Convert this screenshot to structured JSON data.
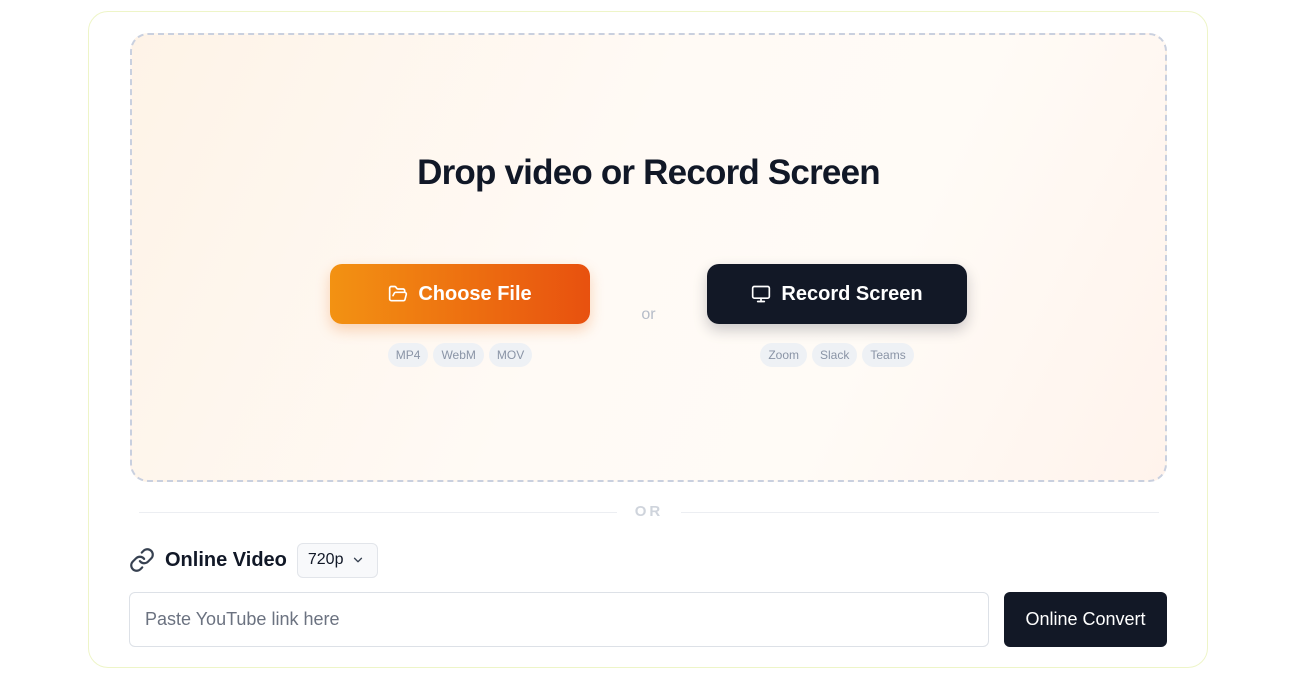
{
  "upload": {
    "title": "Drop video or Record Screen",
    "choose_file_label": "Choose File",
    "file_formats": [
      "MP4",
      "WebM",
      "MOV"
    ],
    "or_text": "or",
    "record_screen_label": "Record Screen",
    "record_sources": [
      "Zoom",
      "Slack",
      "Teams"
    ]
  },
  "separator": {
    "text": "OR"
  },
  "online": {
    "label": "Online Video",
    "quality_selected": "720p",
    "url_placeholder": "Paste YouTube link here",
    "url_value": "",
    "convert_label": "Online Convert"
  },
  "colors": {
    "accent_orange_start": "#f39212",
    "accent_orange_end": "#e8510f",
    "dark_button": "#121826"
  },
  "icons": {
    "choose_file": "folder-open-icon",
    "record_screen": "monitor-icon",
    "online_video": "link-icon",
    "quality_dropdown": "chevron-down-icon"
  }
}
